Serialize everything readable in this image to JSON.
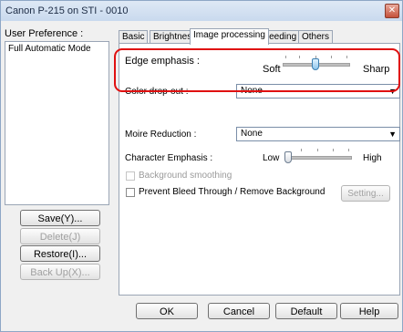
{
  "window": {
    "title": "Canon P-215 on STI - 0010",
    "close_glyph": "✕"
  },
  "sidebar": {
    "header": "User Preference :",
    "items": [
      "Full Automatic Mode"
    ],
    "buttons": {
      "save": "Save(Y)...",
      "delete": "Delete(J)",
      "restore": "Restore(I)...",
      "backup": "Back Up(X)..."
    }
  },
  "tabs": [
    {
      "label": "Basic",
      "active": false
    },
    {
      "label": "Brightness",
      "active": false
    },
    {
      "label": "Image processing",
      "active": true
    },
    {
      "label": "Feeding",
      "active": false
    },
    {
      "label": "Others",
      "active": false
    }
  ],
  "panel": {
    "edge": {
      "label": "Edge emphasis :",
      "low": "Soft",
      "high": "Sharp",
      "level": 0.5
    },
    "color_dropout": {
      "label": "Color drop-out :",
      "value": "None"
    },
    "moire": {
      "label": "Moire Reduction :",
      "value": "None"
    },
    "character": {
      "label": "Character Emphasis :",
      "low": "Low",
      "high": "High",
      "level": 0.0
    },
    "bg_smoothing": {
      "label": "Background smoothing",
      "checked": false,
      "enabled": false
    },
    "bleed": {
      "label": "Prevent Bleed Through / Remove Background",
      "checked": false
    },
    "setting_button": "Setting..."
  },
  "footer": {
    "ok": "OK",
    "cancel": "Cancel",
    "default": "Default",
    "help": "Help"
  },
  "colors": {
    "highlight": "#e01010",
    "slider_thumb": "#8fc6ec"
  }
}
